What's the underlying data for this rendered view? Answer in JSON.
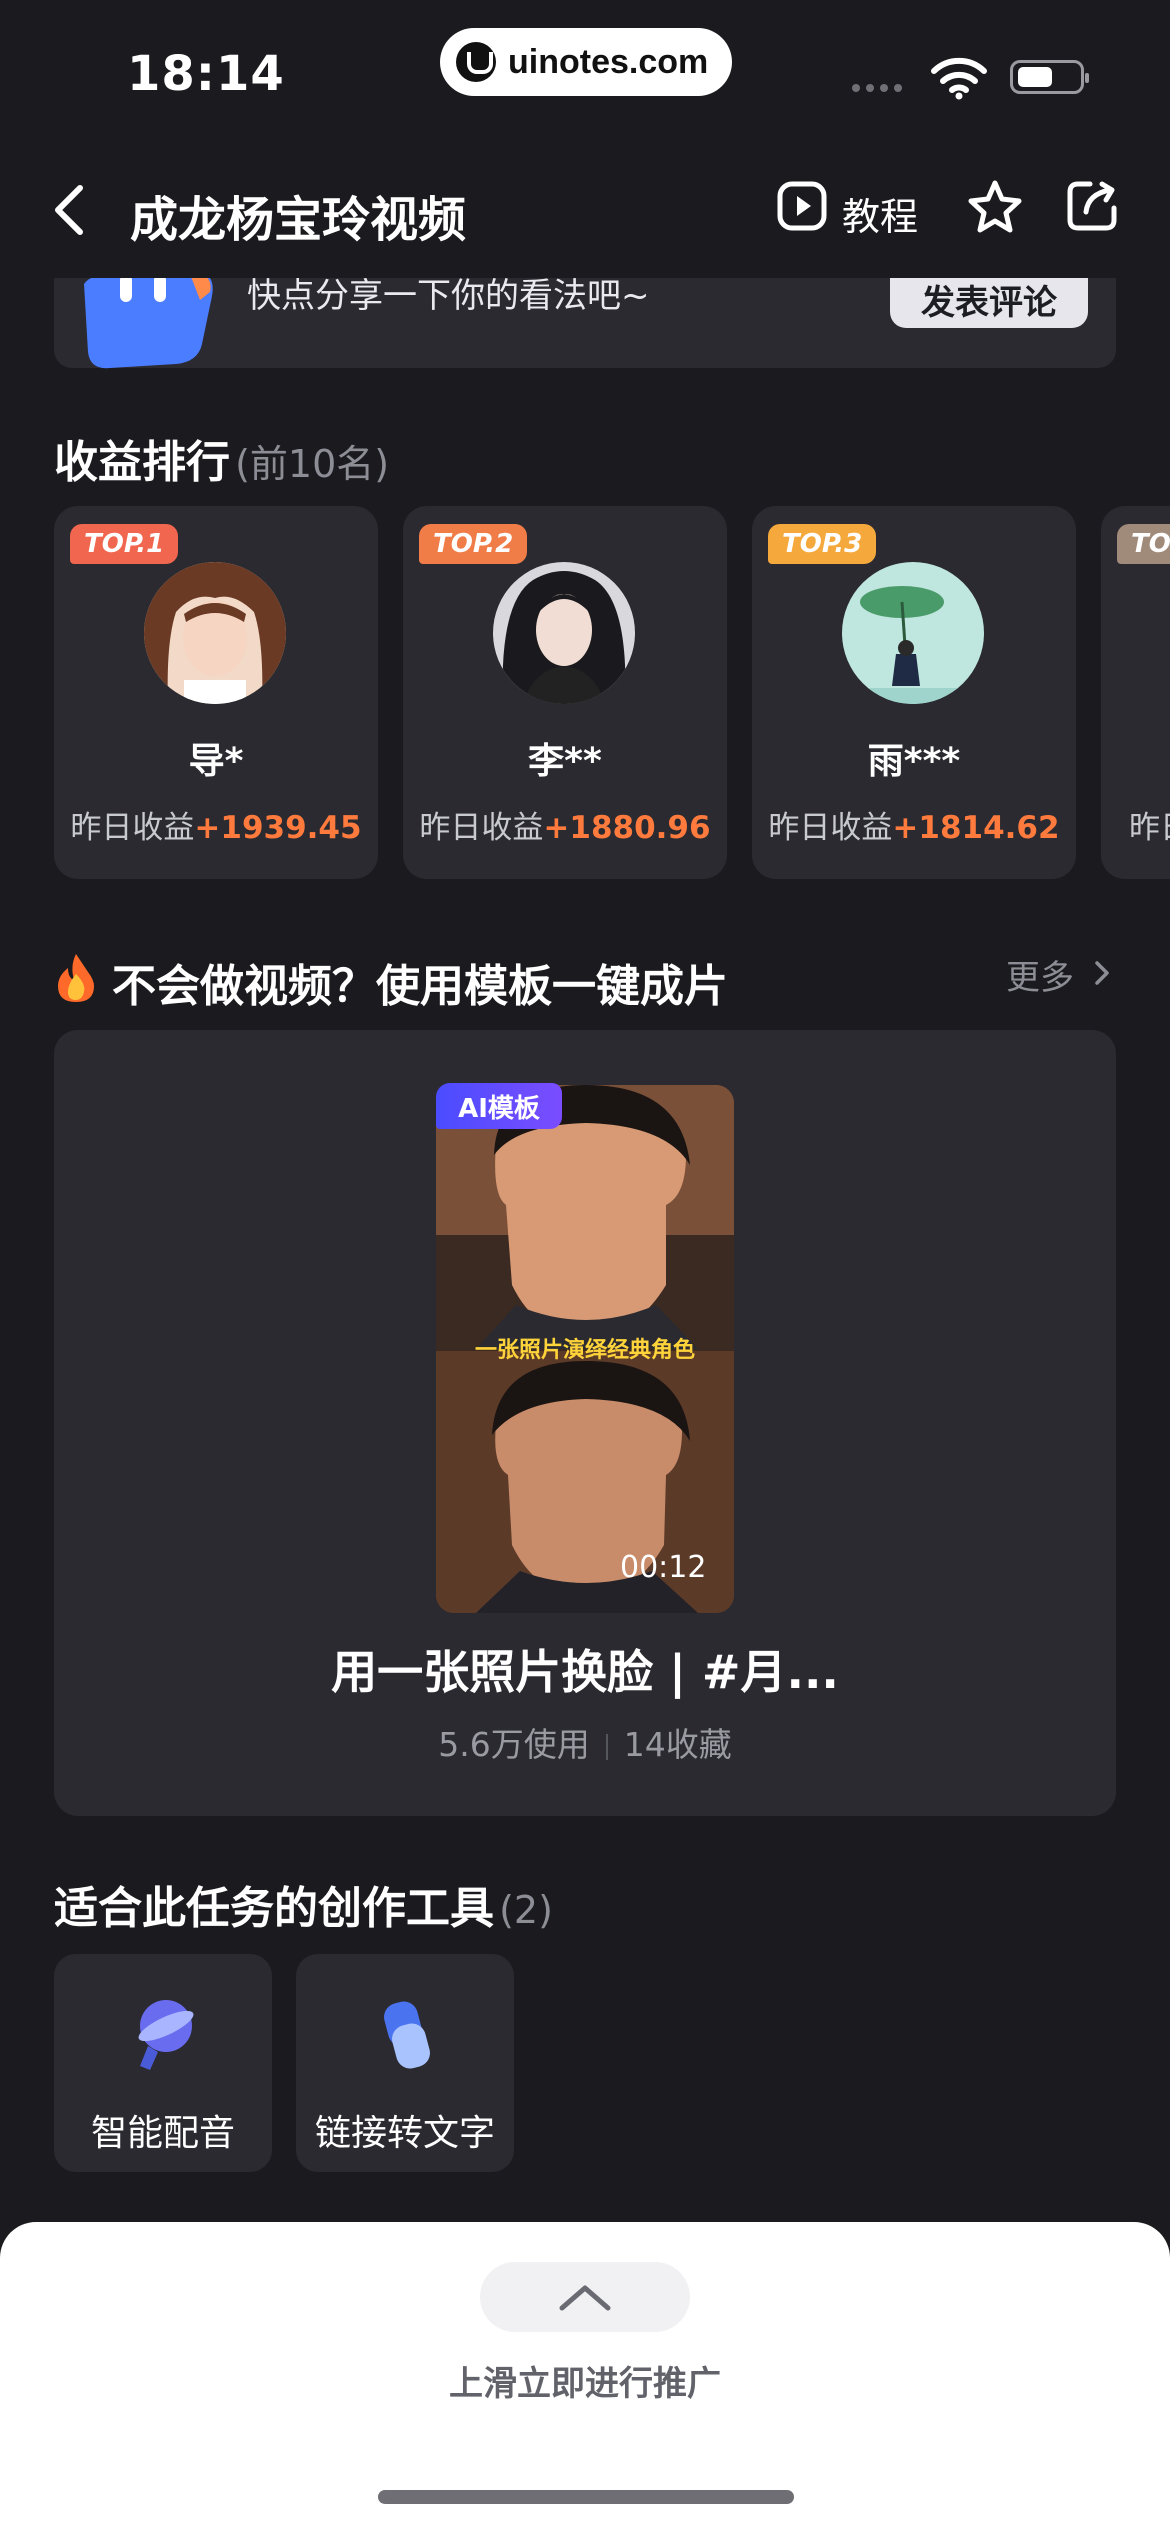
{
  "status_bar": {
    "time": "18:14",
    "watermark": "uinotes.com"
  },
  "nav": {
    "title": "成龙杨宝玲视频",
    "tutorial_label": "教程"
  },
  "comment": {
    "prompt": "快点分享一下你的看法吧~",
    "button": "发表评论"
  },
  "ranking": {
    "title": "收益排行",
    "subtitle": "(前10名)",
    "items": [
      {
        "badge": "TOP.1",
        "name": "导*",
        "label": "昨日收益",
        "amount": "+1939.45",
        "badge_color": "#f0664e"
      },
      {
        "badge": "TOP.2",
        "name": "李**",
        "label": "昨日收益",
        "amount": "+1880.96",
        "badge_color": "#f07c48"
      },
      {
        "badge": "TOP.3",
        "name": "雨***",
        "label": "昨日收益",
        "amount": "+1814.62",
        "badge_color": "#f5a93c"
      },
      {
        "badge": "TOP",
        "name": "",
        "label": "昨日",
        "amount": "",
        "badge_color": "#a08a7a"
      }
    ]
  },
  "templates": {
    "title": "不会做视频？使用模板一键成片",
    "more": "更多",
    "badge": "AI模板",
    "overlay_caption": "一张照片演绎经典角色",
    "duration": "00:12",
    "name": "用一张照片换脸 | #月...",
    "uses": "5.6万使用",
    "favorites": "14收藏"
  },
  "tools": {
    "title": "适合此任务的创作工具",
    "count": "(2)",
    "items": [
      {
        "label": "智能配音",
        "icon": "microphone-icon"
      },
      {
        "label": "链接转文字",
        "icon": "link-icon"
      }
    ]
  },
  "sheet": {
    "text": "上滑立即进行推广"
  },
  "colors": {
    "accent_orange": "#ff7a3d",
    "background": "#1b1b1f",
    "card": "#2a2a30",
    "ai_badge": "#5a4cff"
  }
}
